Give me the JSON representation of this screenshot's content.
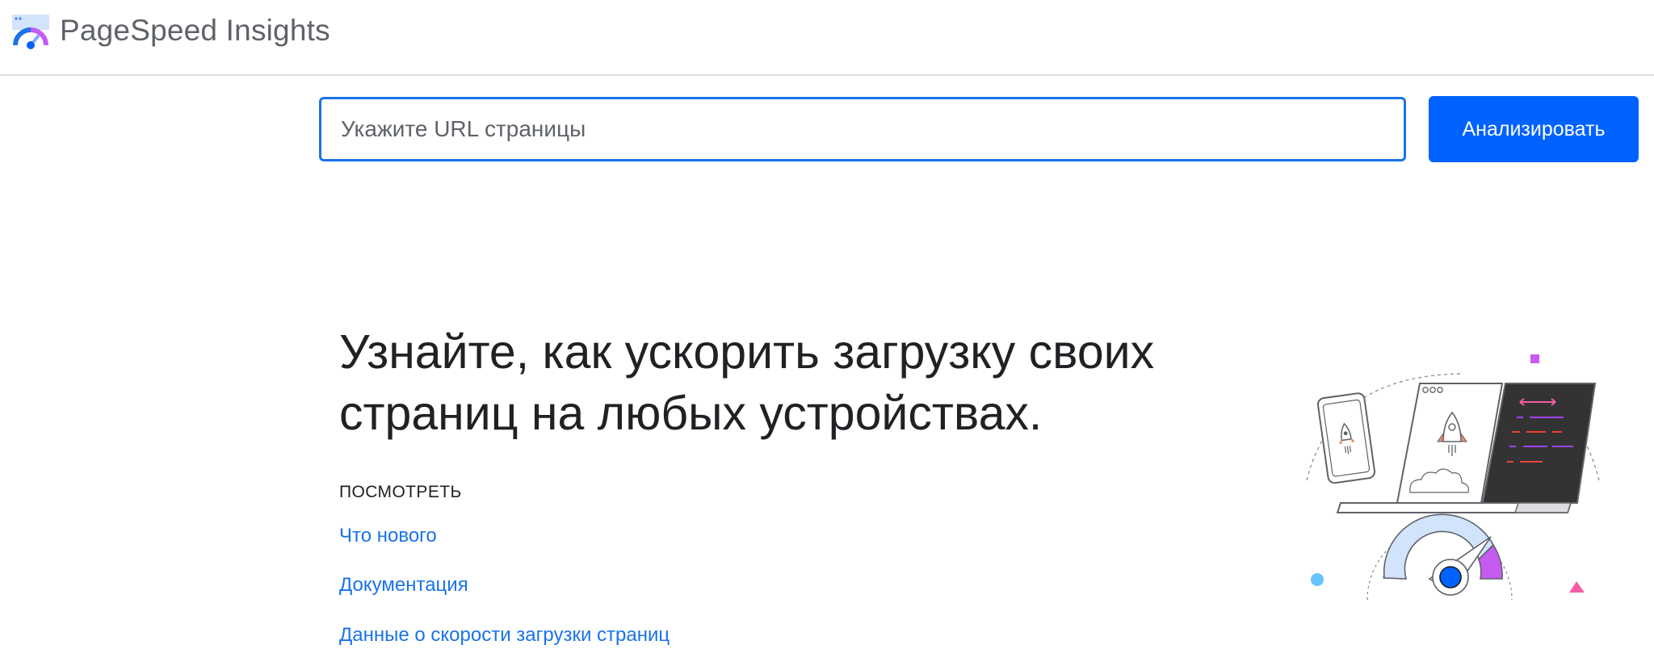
{
  "header": {
    "app_title": "PageSpeed Insights",
    "logo_icon": "pagespeed-gauge-icon"
  },
  "search": {
    "placeholder": "Укажите URL страницы",
    "value": "",
    "button_label": "Анализировать"
  },
  "hero": {
    "heading": "Узнайте, как ускорить загрузку своих страниц на любых устройствах.",
    "view_label": "ПОСМОТРЕТЬ",
    "links": [
      {
        "label": "Что нового"
      },
      {
        "label": "Документация"
      },
      {
        "label": "Данные о скорости загрузки страниц"
      }
    ],
    "illustration_icon": "speed-devices-illustration-icon"
  },
  "colors": {
    "accent": "#0062ff",
    "input_border": "#1a73e8",
    "link": "#1a73e8",
    "text": "#202124",
    "muted": "#5f6368",
    "purple": "#c55bf3",
    "light_blue": "#d2e3fc",
    "dark_panel": "#333333"
  }
}
